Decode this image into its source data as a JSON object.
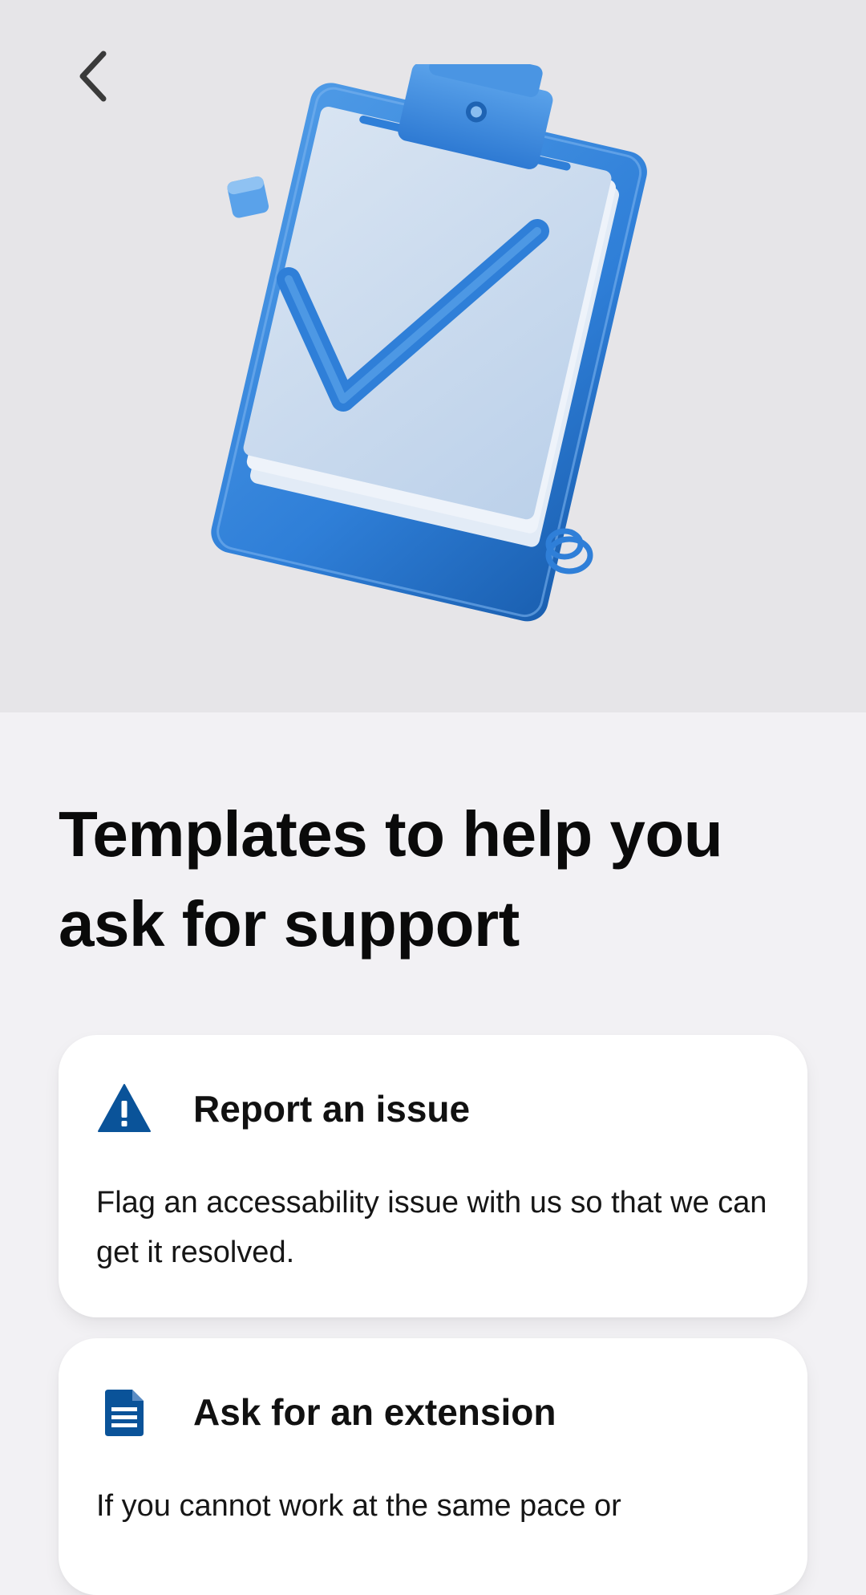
{
  "header": {
    "back_icon": "chevron-left-icon",
    "illustration_icon": "clipboard-checkmark-illustration"
  },
  "main": {
    "title": "Templates to help you ask for support"
  },
  "cards": [
    {
      "icon": "warning-icon",
      "title": "Report an issue",
      "description": "Flag an accessability issue with us so that we can get it resolved."
    },
    {
      "icon": "document-icon",
      "title": "Ask for an extension",
      "description": "If you cannot work at the same pace or"
    }
  ],
  "colors": {
    "accent": "#0a5399",
    "hero_background": "#e6e5e8",
    "page_background": "#f2f1f4",
    "card_background": "#ffffff",
    "illustration_blue": "#2f7fd8"
  }
}
